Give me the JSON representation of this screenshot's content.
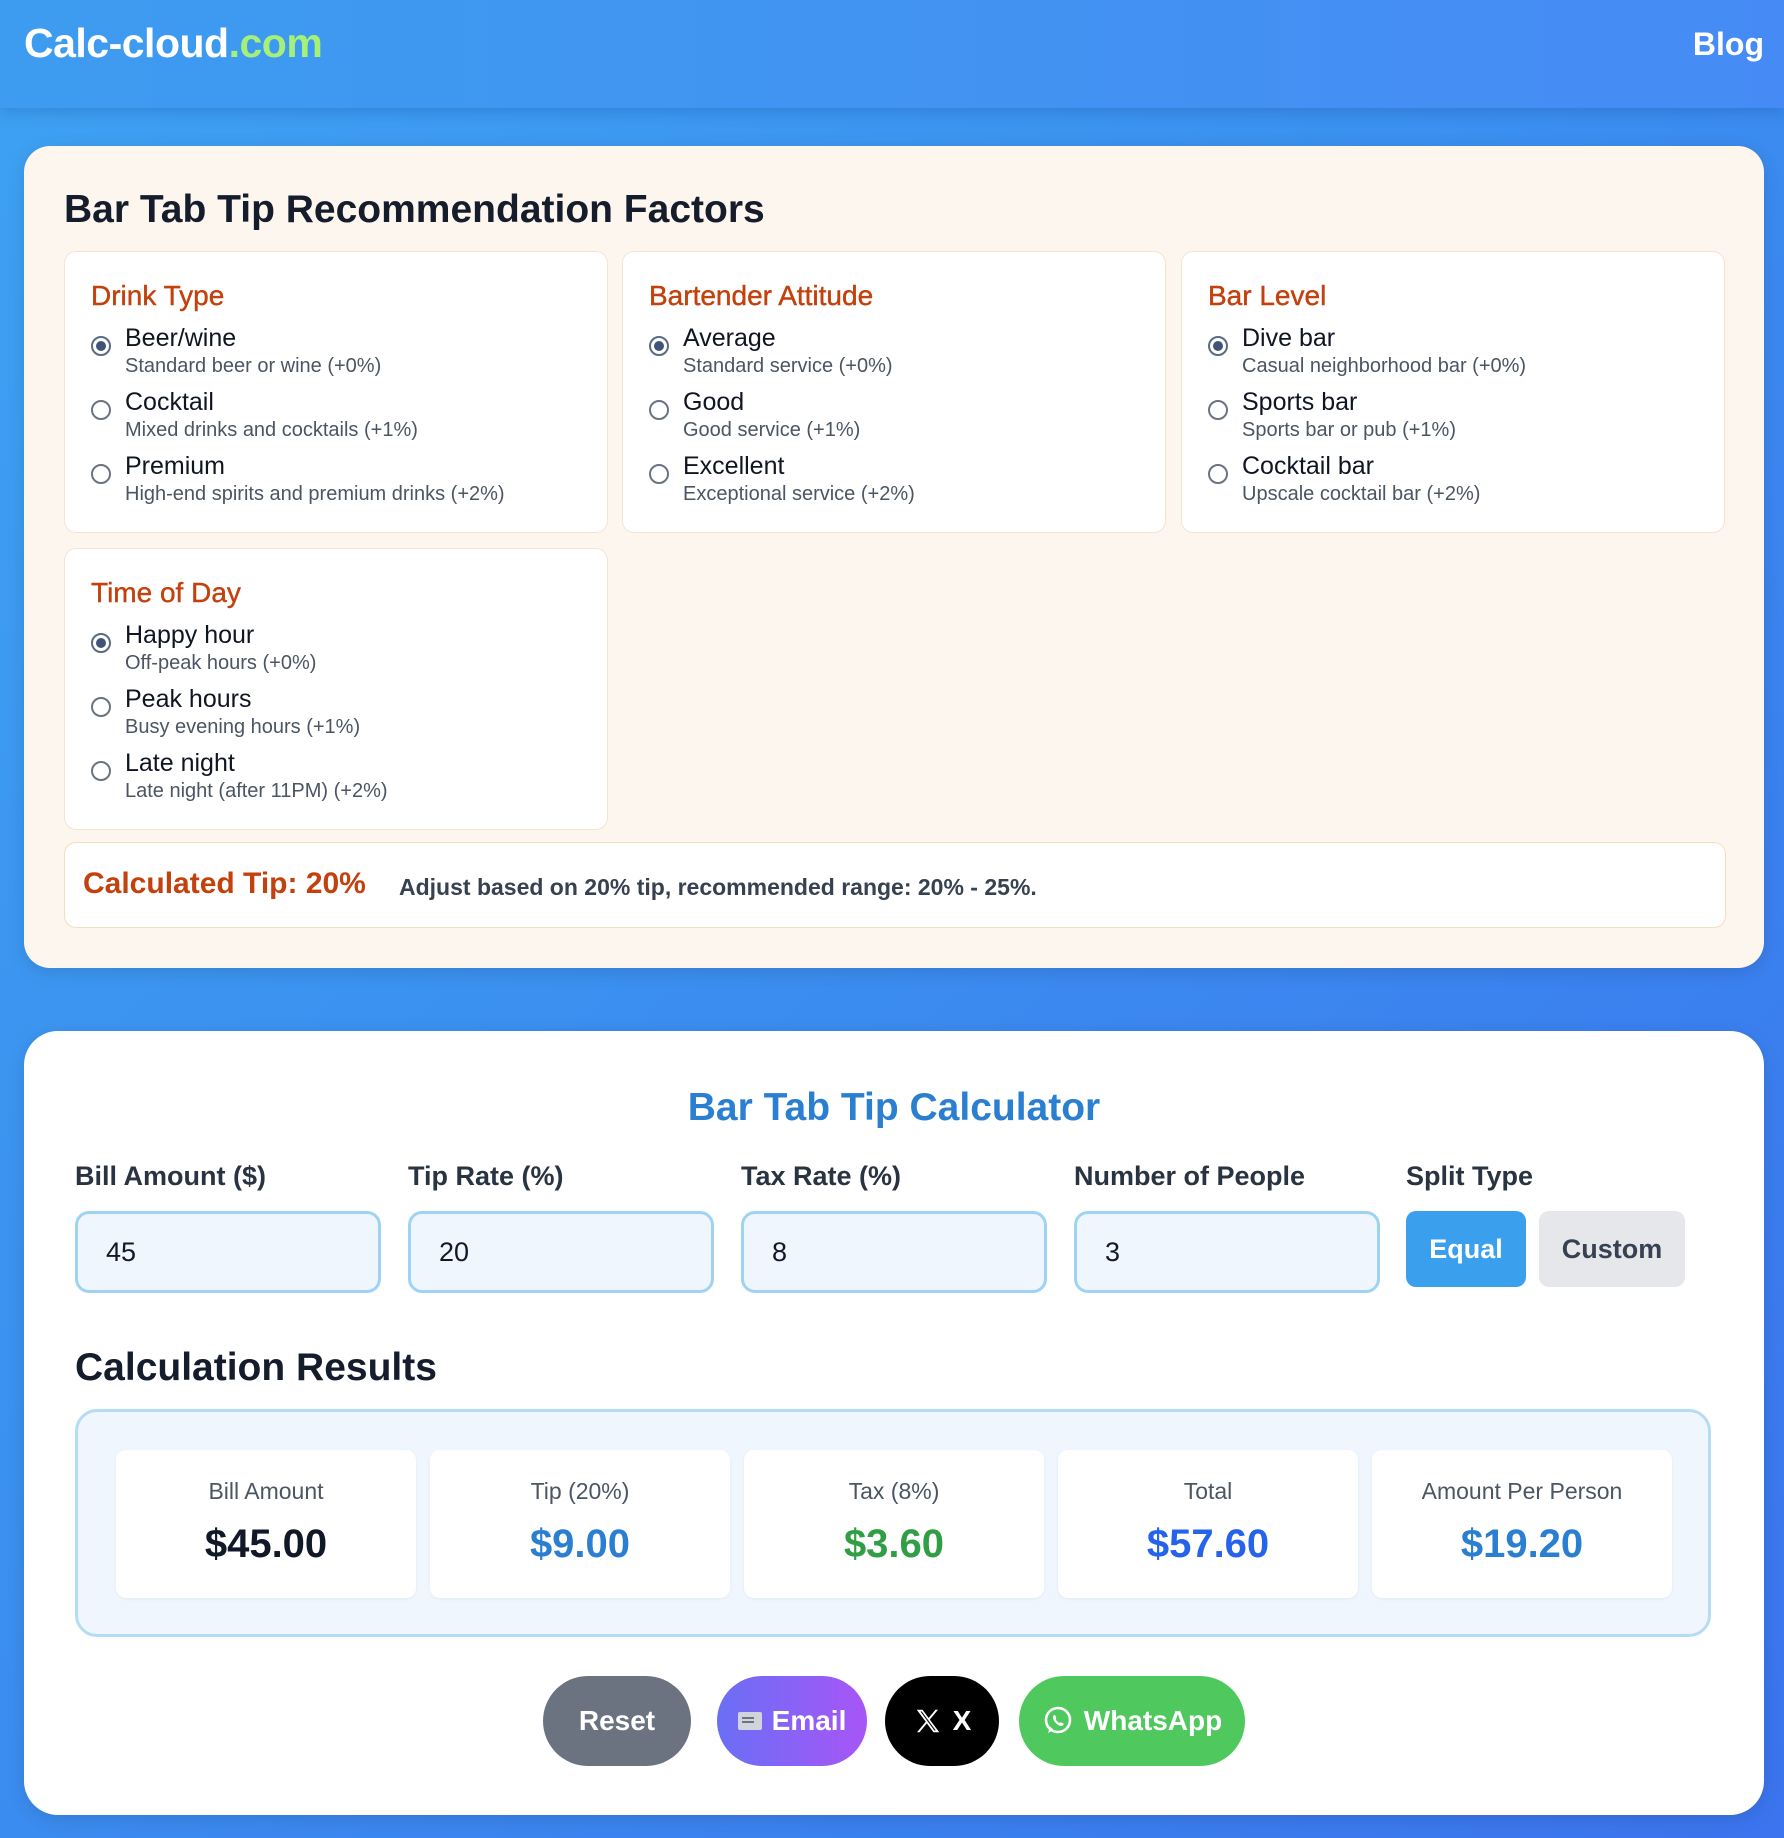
{
  "header": {
    "brand_main": "Calc-cloud",
    "brand_domain": ".com",
    "nav_blog": "Blog"
  },
  "factors": {
    "title": "Bar Tab Tip Recommendation Factors",
    "groups": [
      {
        "title": "Drink Type",
        "options": [
          {
            "label": "Beer/wine",
            "desc": "Standard beer or wine (+0%)",
            "checked": true
          },
          {
            "label": "Cocktail",
            "desc": "Mixed drinks and cocktails (+1%)",
            "checked": false
          },
          {
            "label": "Premium",
            "desc": "High-end spirits and premium drinks (+2%)",
            "checked": false
          }
        ]
      },
      {
        "title": "Bartender Attitude",
        "options": [
          {
            "label": "Average",
            "desc": "Standard service (+0%)",
            "checked": true
          },
          {
            "label": "Good",
            "desc": "Good service (+1%)",
            "checked": false
          },
          {
            "label": "Excellent",
            "desc": "Exceptional service (+2%)",
            "checked": false
          }
        ]
      },
      {
        "title": "Bar Level",
        "options": [
          {
            "label": "Dive bar",
            "desc": "Casual neighborhood bar (+0%)",
            "checked": true
          },
          {
            "label": "Sports bar",
            "desc": "Sports bar or pub (+1%)",
            "checked": false
          },
          {
            "label": "Cocktail bar",
            "desc": "Upscale cocktail bar (+2%)",
            "checked": false
          }
        ]
      },
      {
        "title": "Time of Day",
        "options": [
          {
            "label": "Happy hour",
            "desc": "Off-peak hours (+0%)",
            "checked": true
          },
          {
            "label": "Peak hours",
            "desc": "Busy evening hours (+1%)",
            "checked": false
          },
          {
            "label": "Late night",
            "desc": "Late night (after 11PM) (+2%)",
            "checked": false
          }
        ]
      }
    ],
    "calculated_label": "Calculated Tip: 20%",
    "calculated_note": "Adjust based on 20% tip, recommended range: 20% - 25%."
  },
  "calculator": {
    "title": "Bar Tab Tip Calculator",
    "fields": [
      {
        "label": "Bill Amount ($)",
        "value": "45"
      },
      {
        "label": "Tip Rate (%)",
        "value": "20"
      },
      {
        "label": "Tax Rate (%)",
        "value": "8"
      },
      {
        "label": "Number of People",
        "value": "3"
      }
    ],
    "split_label": "Split Type",
    "split_equal": "Equal",
    "split_custom": "Custom",
    "selected_split": "Equal"
  },
  "results": {
    "title": "Calculation Results",
    "items": [
      {
        "label": "Bill Amount",
        "value": "$45.00",
        "color": "#111827"
      },
      {
        "label": "Tip (20%)",
        "value": "$9.00",
        "color": "#2b7fd0"
      },
      {
        "label": "Tax (8%)",
        "value": "$3.60",
        "color": "#2f9e44"
      },
      {
        "label": "Total",
        "value": "$57.60",
        "color": "#2563eb"
      },
      {
        "label": "Amount Per Person",
        "value": "$19.20",
        "color": "#2b7fd0"
      }
    ]
  },
  "actions": {
    "reset": "Reset",
    "email": "Email",
    "x": "X",
    "whatsapp": "WhatsApp"
  },
  "icons": {
    "email": "envelope-icon",
    "x": "x-logo-icon",
    "whatsapp": "whatsapp-icon"
  }
}
